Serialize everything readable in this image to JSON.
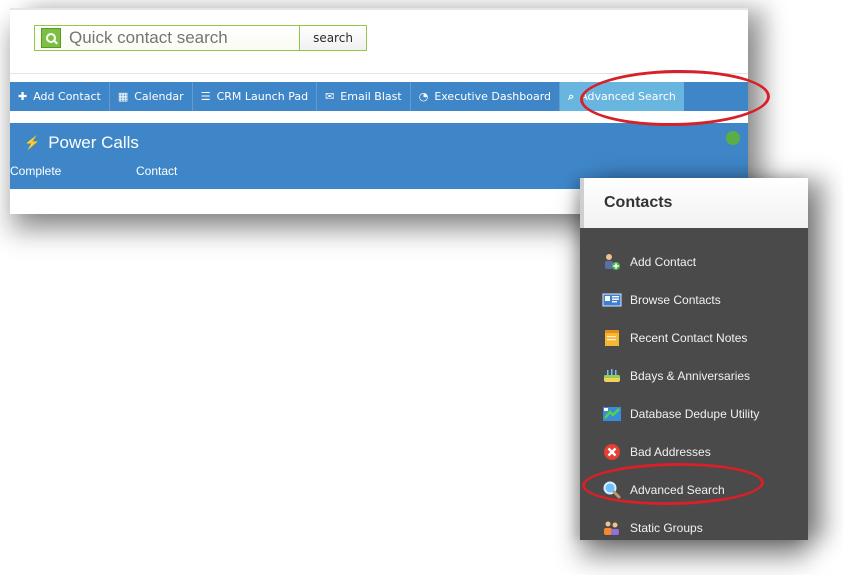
{
  "top": {
    "search_placeholder": "Quick contact search",
    "search_button": "search"
  },
  "nav": {
    "items": [
      {
        "label": "Add Contact",
        "icon": "plus-icon"
      },
      {
        "label": "Calendar",
        "icon": "calendar-icon"
      },
      {
        "label": "CRM Launch Pad",
        "icon": "menu-lines-icon"
      },
      {
        "label": "Email Blast",
        "icon": "envelope-icon"
      },
      {
        "label": "Executive Dashboard",
        "icon": "gauge-icon"
      },
      {
        "label": "Advanced Search",
        "icon": "search-icon"
      }
    ]
  },
  "power_calls": {
    "title": "Power Calls",
    "columns": [
      "Complete",
      "Contact"
    ]
  },
  "sidebar": {
    "header": "Contacts",
    "items": [
      {
        "label": "Add Contact",
        "icon": "add-contact-icon"
      },
      {
        "label": "Browse Contacts",
        "icon": "browse-contacts-icon"
      },
      {
        "label": "Recent Contact Notes",
        "icon": "recent-notes-icon"
      },
      {
        "label": "Bdays & Anniversaries",
        "icon": "cake-icon"
      },
      {
        "label": "Database Dedupe Utility",
        "icon": "dedupe-icon"
      },
      {
        "label": "Bad Addresses",
        "icon": "bad-addresses-icon"
      },
      {
        "label": "Advanced Search",
        "icon": "advanced-search-icon"
      },
      {
        "label": "Static Groups",
        "icon": "static-groups-icon"
      }
    ]
  },
  "colors": {
    "nav_blue": "#3f86c8",
    "nav_active": "#68b5df",
    "sidebar_dark": "#4a4a4a",
    "annotation_red": "#d72027"
  }
}
